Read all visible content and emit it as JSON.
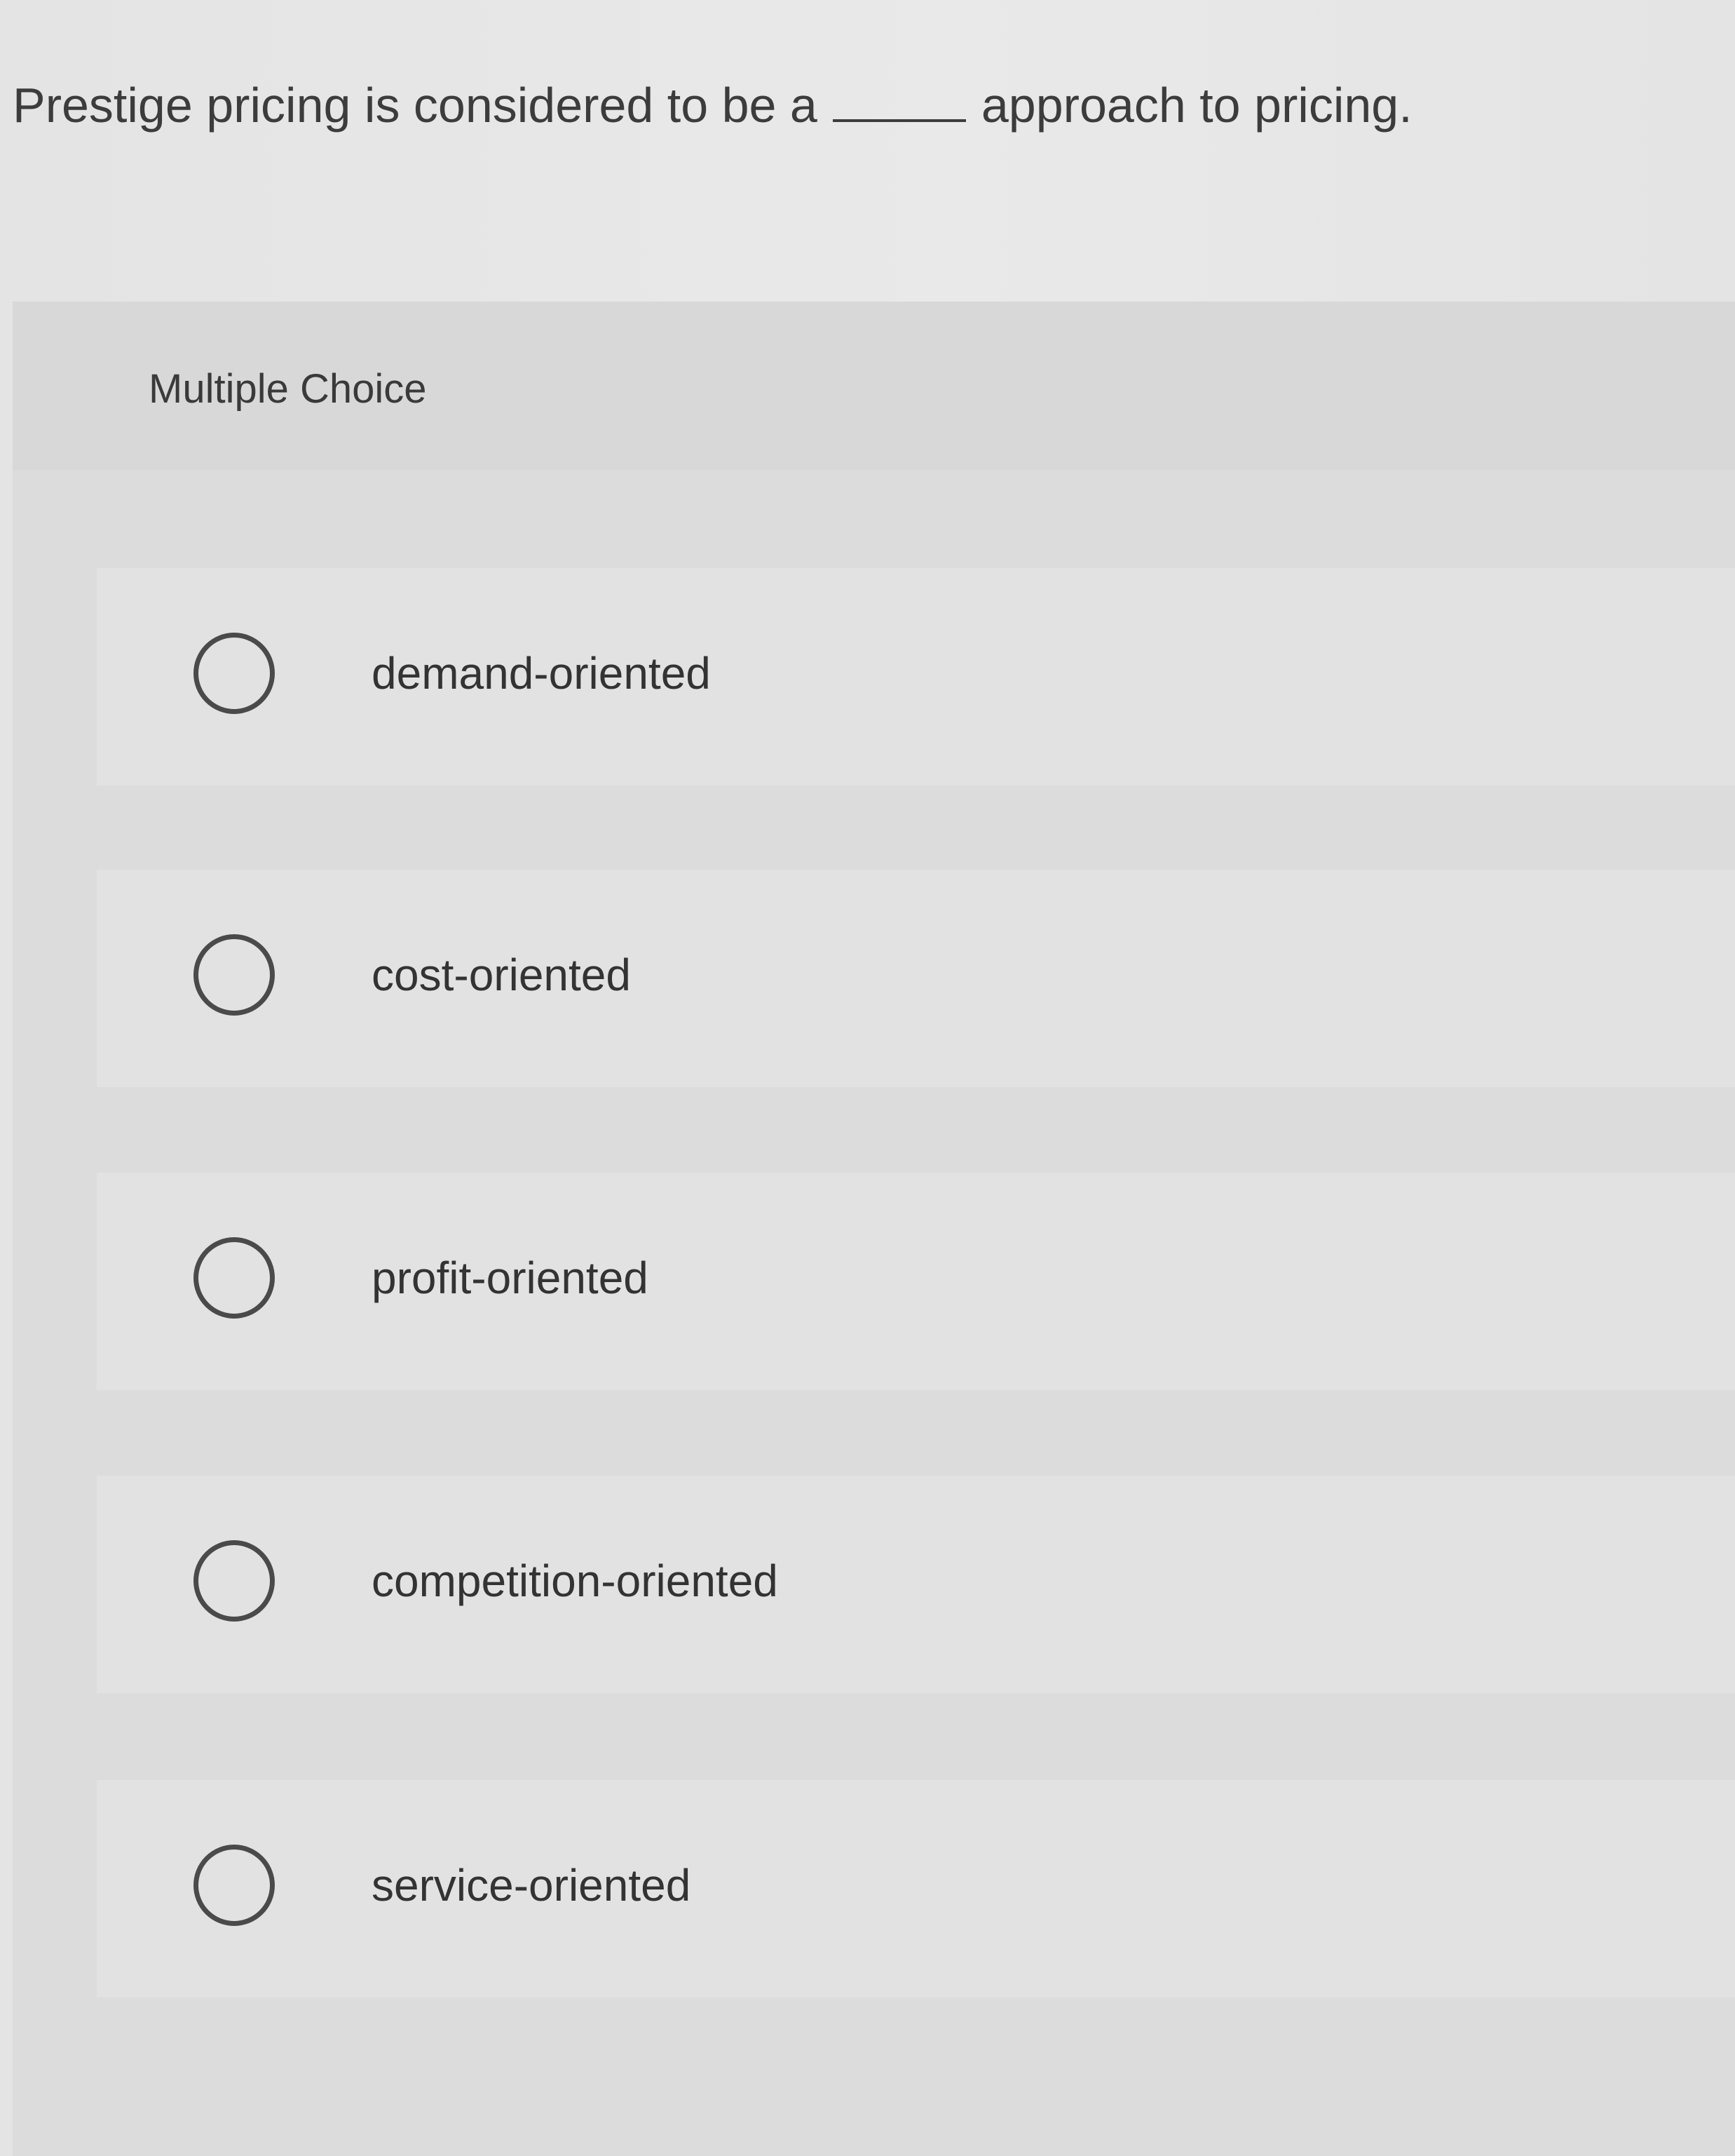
{
  "question": {
    "text_before": "Prestige pricing is considered to be a",
    "text_after": "approach to pricing."
  },
  "panel": {
    "type_label": "Multiple Choice"
  },
  "options": [
    {
      "label": "demand-oriented"
    },
    {
      "label": "cost-oriented"
    },
    {
      "label": "profit-oriented"
    },
    {
      "label": "competition-oriented"
    },
    {
      "label": "service-oriented"
    }
  ],
  "icons": {
    "option_radio": "radio-unchecked-icon"
  }
}
